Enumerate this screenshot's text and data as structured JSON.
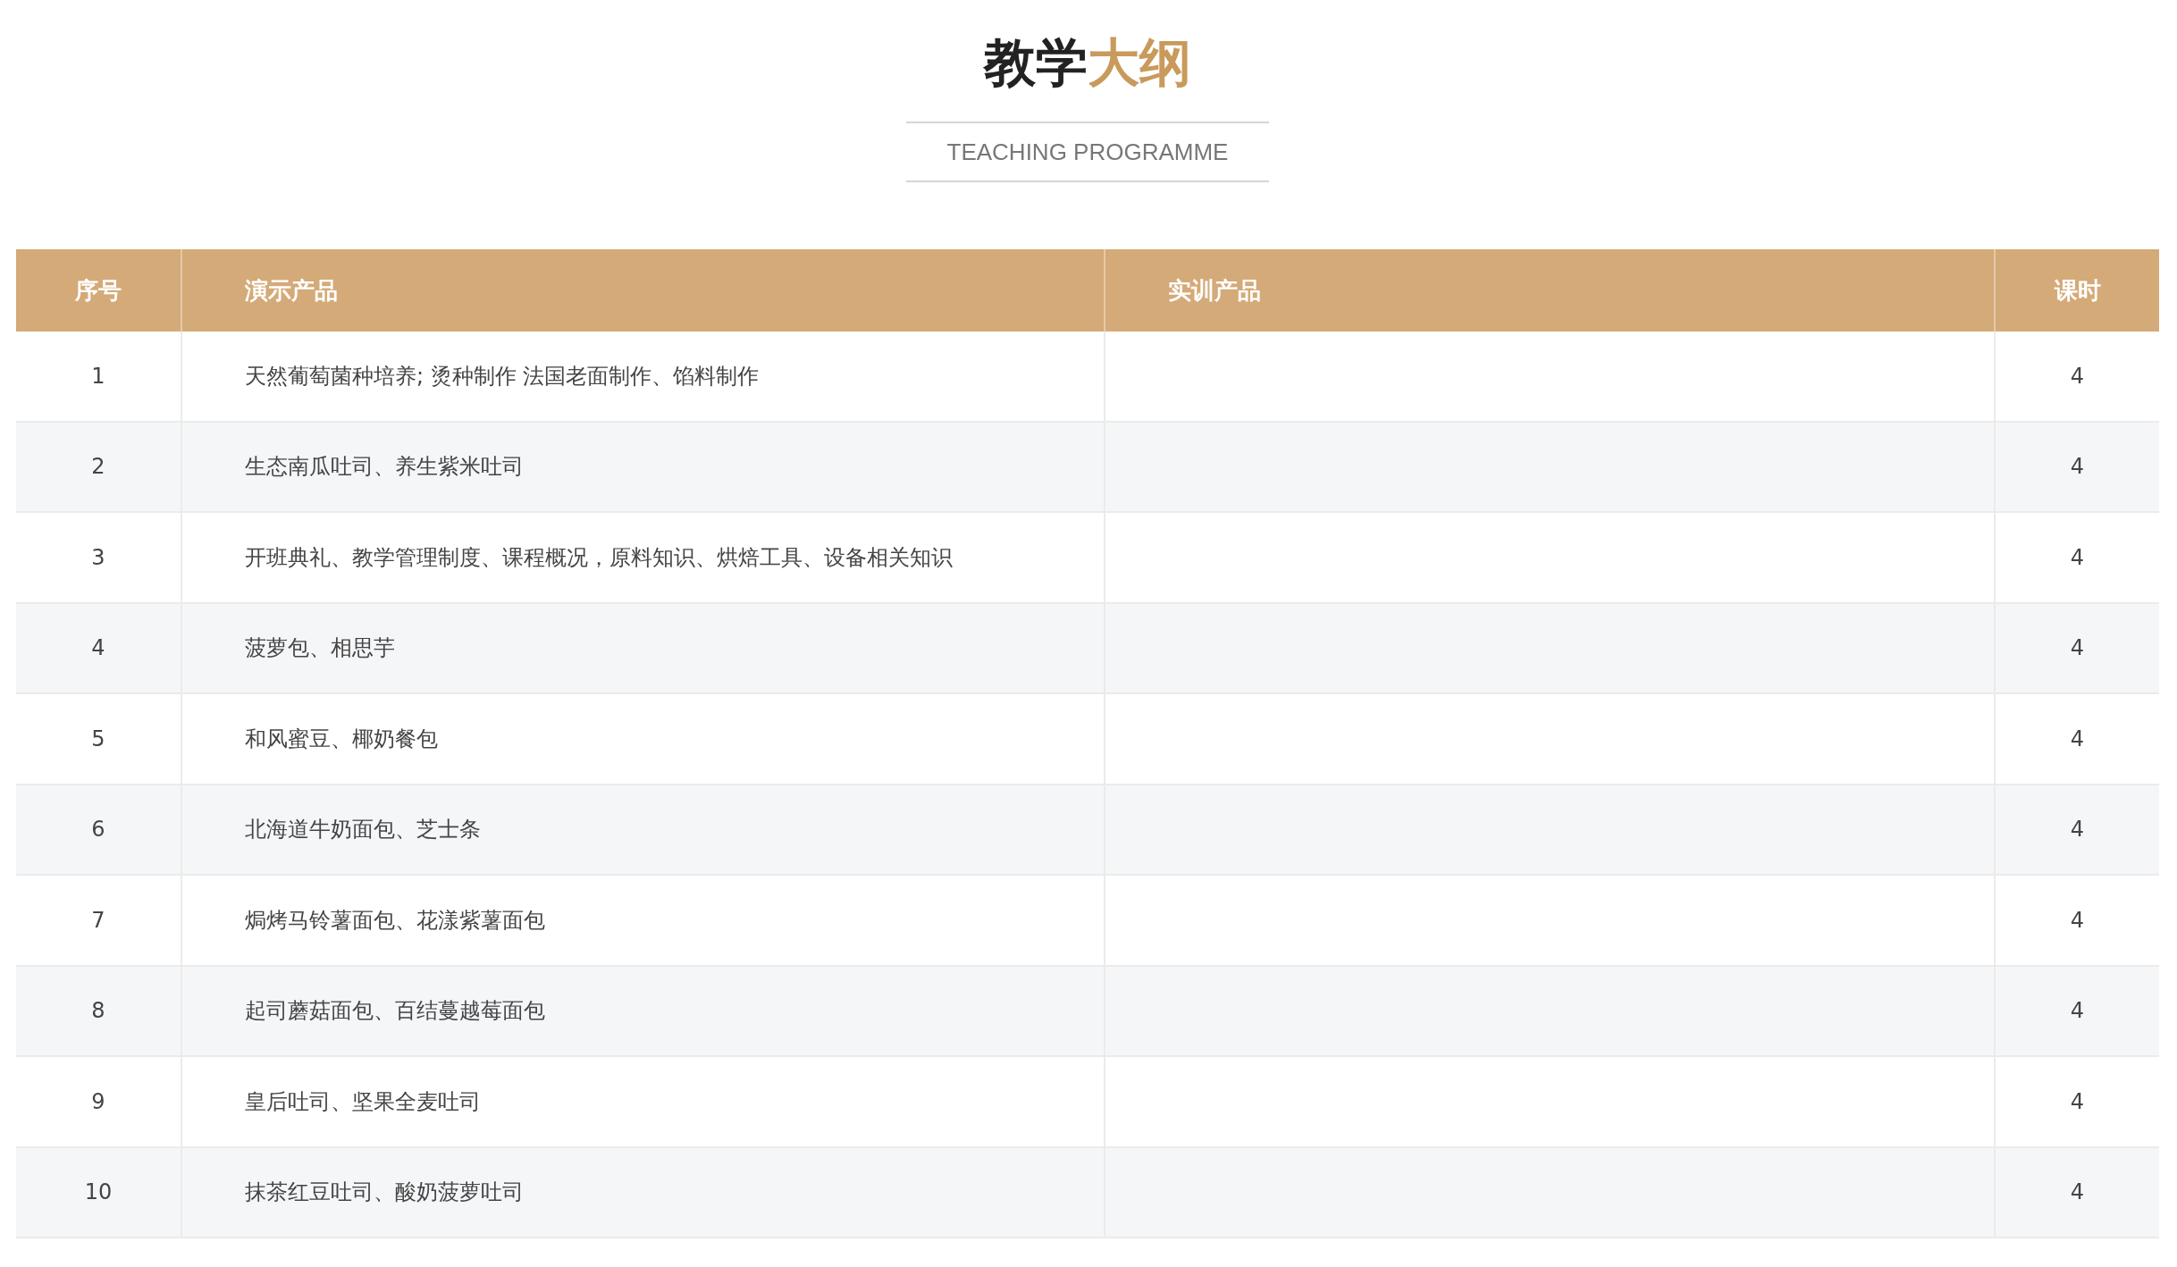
{
  "title": {
    "parts": [
      {
        "text": "教学",
        "kind": "plain"
      },
      {
        "text": "大纲",
        "kind": "accent"
      }
    ]
  },
  "subtitle": "TEACHING PROGRAMME",
  "table": {
    "columns": [
      "序号",
      "演示产品",
      "实训产品",
      "课时"
    ],
    "rows": [
      {
        "number": "1",
        "demo_product": "天然葡萄菌种培养; 烫种制作 法国老面制作、馅料制作",
        "hours": "4"
      },
      {
        "number": "2",
        "demo_product": "生态南瓜吐司、养生紫米吐司",
        "hours": "4"
      },
      {
        "number": "3",
        "demo_product": "开班典礼、教学管理制度、课程概况，原料知识、烘焙工具、设备相关知识",
        "hours": "4"
      },
      {
        "number": "4",
        "demo_product": "菠萝包、相思芋",
        "hours": "4"
      },
      {
        "number": "5",
        "demo_product": "和风蜜豆、椰奶餐包",
        "hours": "4"
      },
      {
        "number": "6",
        "demo_product": "北海道牛奶面包、芝士条",
        "hours": "4"
      },
      {
        "number": "7",
        "demo_product": "焗烤马铃薯面包、花漾紫薯面包",
        "hours": "4"
      },
      {
        "number": "8",
        "demo_product": "起司蘑菇面包、百结蔓越莓面包",
        "hours": "4"
      },
      {
        "number": "9",
        "demo_product": "皇后吐司、坚果全麦吐司",
        "hours": "4"
      },
      {
        "number": "10",
        "demo_product": "抹茶红豆吐司、酸奶菠萝吐司",
        "hours": "4"
      }
    ]
  }
}
